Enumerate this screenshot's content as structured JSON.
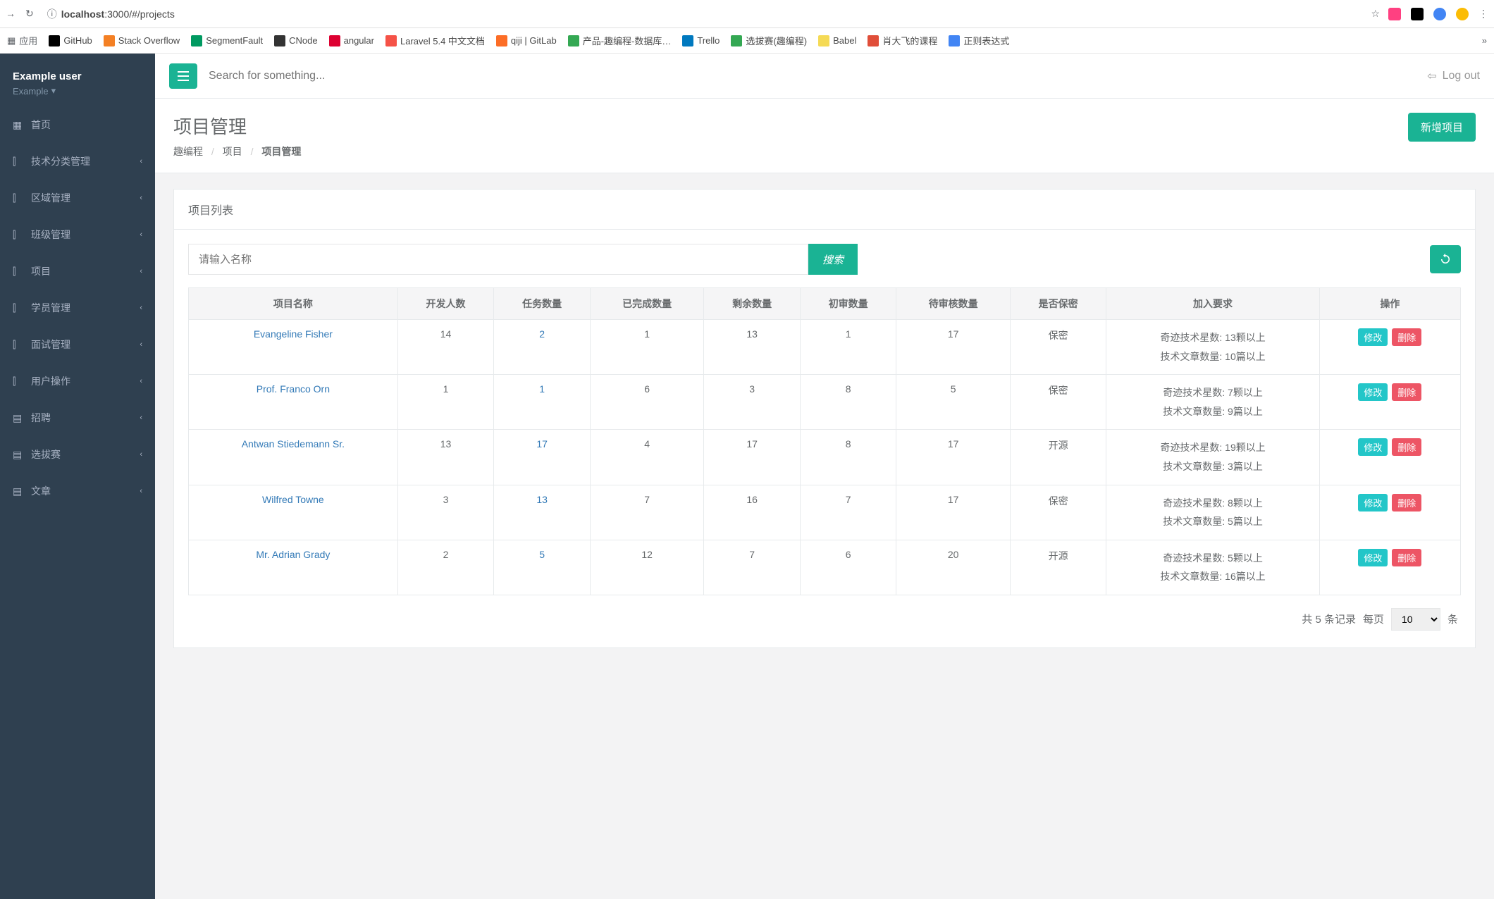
{
  "browser": {
    "url_prefix": "localhost",
    "url_path": ":3000/#/projects",
    "bookmarks": [
      {
        "label": "应用",
        "color": "#5f6368"
      },
      {
        "label": "GitHub",
        "color": "#000"
      },
      {
        "label": "Stack Overflow",
        "color": "#f48024"
      },
      {
        "label": "SegmentFault",
        "color": "#009a61"
      },
      {
        "label": "CNode",
        "color": "#333"
      },
      {
        "label": "angular",
        "color": "#dd0031"
      },
      {
        "label": "Laravel 5.4 中文文档",
        "color": "#f55247"
      },
      {
        "label": "qiji | GitLab",
        "color": "#fc6d26"
      },
      {
        "label": "产品-趣编程-数据库…",
        "color": "#34a853"
      },
      {
        "label": "Trello",
        "color": "#0079bf"
      },
      {
        "label": "选拔赛(趣编程)",
        "color": "#34a853"
      },
      {
        "label": "Babel",
        "color": "#f5da55"
      },
      {
        "label": "肖大飞的课程",
        "color": "#e04e39"
      },
      {
        "label": "正则表达式",
        "color": "#4285f4"
      }
    ]
  },
  "user": {
    "name": "Example user",
    "sub": "Example"
  },
  "sidebar": {
    "items": [
      {
        "label": "首页",
        "expandable": false
      },
      {
        "label": "技术分类管理",
        "expandable": true
      },
      {
        "label": "区域管理",
        "expandable": true
      },
      {
        "label": "班级管理",
        "expandable": true
      },
      {
        "label": "项目",
        "expandable": true
      },
      {
        "label": "学员管理",
        "expandable": true
      },
      {
        "label": "面试管理",
        "expandable": true
      },
      {
        "label": "用户操作",
        "expandable": true
      },
      {
        "label": "招聘",
        "expandable": true
      },
      {
        "label": "选拔赛",
        "expandable": true
      },
      {
        "label": "文章",
        "expandable": true
      }
    ]
  },
  "topbar": {
    "search_placeholder": "Search for something...",
    "logout": "Log out"
  },
  "page": {
    "title": "项目管理",
    "breadcrumb": [
      "趣编程",
      "项目",
      "项目管理"
    ],
    "add_button": "新增项目"
  },
  "panel": {
    "title": "项目列表",
    "search_placeholder": "请输入名称",
    "search_btn": "搜索"
  },
  "table": {
    "headers": [
      "项目名称",
      "开发人数",
      "任务数量",
      "已完成数量",
      "剩余数量",
      "初审数量",
      "待审核数量",
      "是否保密",
      "加入要求",
      "操作"
    ],
    "edit_label": "修改",
    "delete_label": "删除",
    "rows": [
      {
        "name": "Evangeline Fisher",
        "dev": "14",
        "tasks": "2",
        "done": "1",
        "remain": "13",
        "first": "1",
        "pending": "17",
        "secret": "保密",
        "req1": "奇迹技术星数: 13颗以上",
        "req2": "技术文章数量: 10篇以上"
      },
      {
        "name": "Prof. Franco Orn",
        "dev": "1",
        "tasks": "1",
        "done": "6",
        "remain": "3",
        "first": "8",
        "pending": "5",
        "secret": "保密",
        "req1": "奇迹技术星数: 7颗以上",
        "req2": "技术文章数量: 9篇以上"
      },
      {
        "name": "Antwan Stiedemann Sr.",
        "dev": "13",
        "tasks": "17",
        "done": "4",
        "remain": "17",
        "first": "8",
        "pending": "17",
        "secret": "开源",
        "req1": "奇迹技术星数: 19颗以上",
        "req2": "技术文章数量: 3篇以上"
      },
      {
        "name": "Wilfred Towne",
        "dev": "3",
        "tasks": "13",
        "done": "7",
        "remain": "16",
        "first": "7",
        "pending": "17",
        "secret": "保密",
        "req1": "奇迹技术星数: 8颗以上",
        "req2": "技术文章数量: 5篇以上"
      },
      {
        "name": "Mr. Adrian Grady",
        "dev": "2",
        "tasks": "5",
        "done": "12",
        "remain": "7",
        "first": "6",
        "pending": "20",
        "secret": "开源",
        "req1": "奇迹技术星数: 5颗以上",
        "req2": "技术文章数量: 16篇以上"
      }
    ]
  },
  "pager": {
    "total_text": "共 5 条记录",
    "per_page_label": "每页",
    "per_page_value": "10",
    "per_page_suffix": "条"
  }
}
